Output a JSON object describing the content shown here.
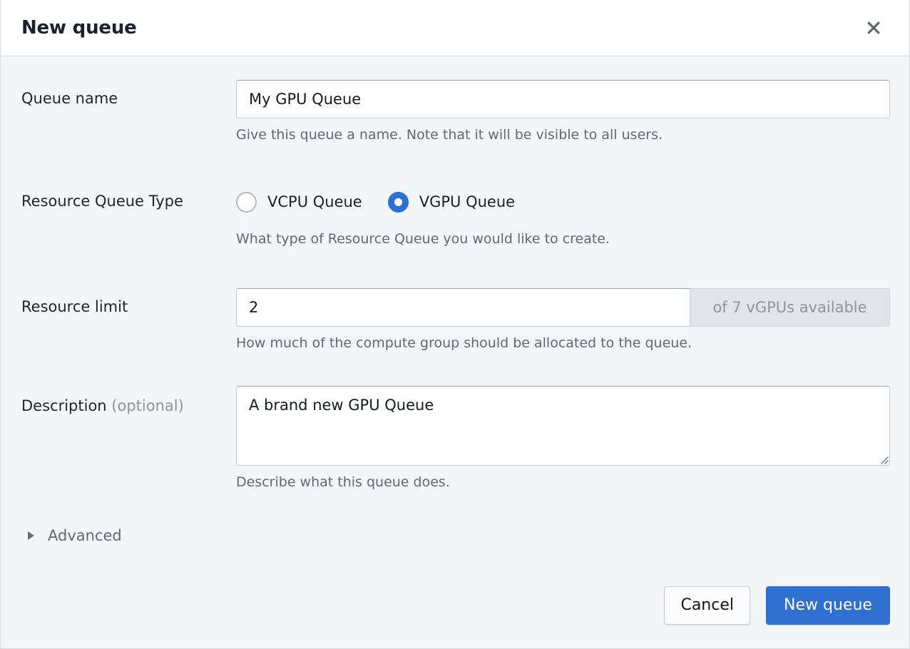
{
  "dialog": {
    "title": "New queue",
    "close_icon": "close-icon",
    "close_label": "Close"
  },
  "form": {
    "queue_name": {
      "label": "Queue name",
      "value": "My GPU Queue",
      "placeholder": "",
      "help": "Give this queue a name. Note that it will be visible to all users."
    },
    "resource_queue_type": {
      "label": "Resource Queue Type",
      "help": "What type of Resource Queue you would like to create.",
      "selected": "VGPU Queue",
      "options": [
        {
          "label": "VCPU Queue",
          "selected": false
        },
        {
          "label": "VGPU Queue",
          "selected": true
        }
      ]
    },
    "resource_limit": {
      "label": "Resource limit",
      "value": "2",
      "placeholder": "",
      "addon": "of 7 vGPUs available",
      "help": "How much of the compute group should be allocated to the queue."
    },
    "description": {
      "label": "Description",
      "label_optional": "(optional)",
      "value": "A brand new GPU Queue",
      "placeholder": "",
      "help": "Describe what this queue does."
    },
    "advanced": {
      "label": "Advanced",
      "expanded": false,
      "disclosure_icon": "triangle-right-icon"
    }
  },
  "footer": {
    "cancel_label": "Cancel",
    "submit_label": "New queue"
  },
  "colors": {
    "accent": "#2f6fd0",
    "body_background": "#f4f5f7",
    "header_background": "#ffffff",
    "label_text": "#1f242c",
    "help_text": "#5d6878",
    "addon_background": "#e2e4e9",
    "addon_text": "#8d94a0",
    "border": "#c9ccd2"
  }
}
